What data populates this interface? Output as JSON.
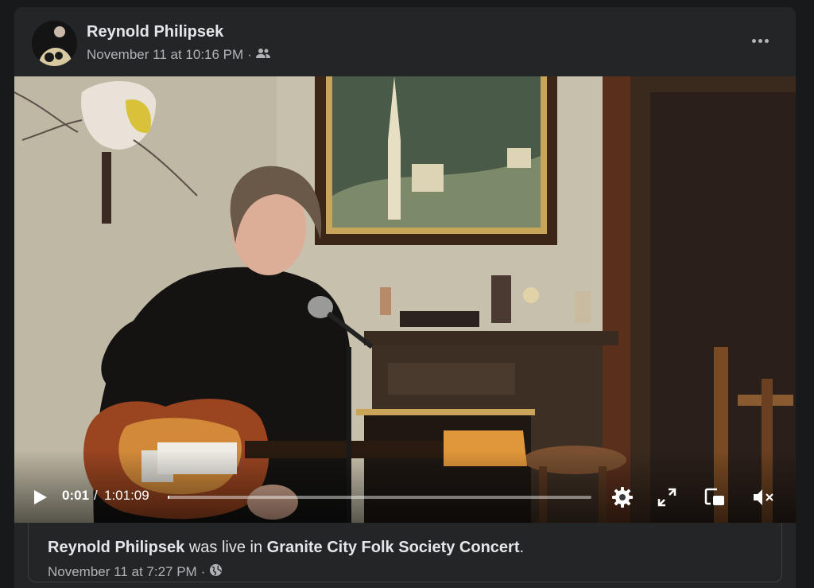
{
  "post": {
    "author": "Reynold Philipsek",
    "date": "November 11 at 10:16 PM",
    "separator": "·",
    "audience_icon": "friends-icon",
    "more_icon": "more-horizontal-icon"
  },
  "video": {
    "current_time": "0:01",
    "time_separator": "/",
    "duration": "1:01:09",
    "progress_fraction": 0.003,
    "icons": [
      "play-icon",
      "settings-gear-icon",
      "fullscreen-icon",
      "picture-in-picture-icon",
      "volume-muted-icon"
    ]
  },
  "attachment": {
    "author": "Reynold Philipsek",
    "verb": " was live in ",
    "event": "Granite City Folk Society Concert",
    "period": ".",
    "date": "November 11 at 7:27 PM",
    "separator": "·",
    "privacy_icon": "globe-icon"
  },
  "colors": {
    "page_bg": "#18191a",
    "card_bg": "#242526",
    "text_primary": "#e4e6eb",
    "text_secondary": "#b0b3b8"
  }
}
